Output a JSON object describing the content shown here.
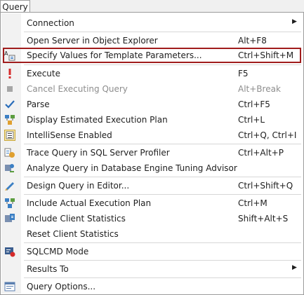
{
  "menubar": {
    "title": "Query"
  },
  "menu": {
    "connection": {
      "label": "Connection",
      "has_submenu": true
    },
    "open_server": {
      "label": "Open Server in Object Explorer",
      "shortcut": "Alt+F8"
    },
    "specify_values": {
      "label": "Specify Values for Template Parameters...",
      "shortcut": "Ctrl+Shift+M",
      "icon": "template-parameters-icon"
    },
    "execute": {
      "label": "Execute",
      "shortcut": "F5",
      "icon": "execute-icon",
      "icon_color": "#d62b2b"
    },
    "cancel": {
      "label": "Cancel Executing Query",
      "shortcut": "Alt+Break",
      "icon": "stop-icon",
      "disabled": true
    },
    "parse": {
      "label": "Parse",
      "shortcut": "Ctrl+F5",
      "icon": "checkmark-icon",
      "icon_color": "#2a6dba"
    },
    "display_plan": {
      "label": "Display Estimated Execution Plan",
      "shortcut": "Ctrl+L",
      "icon": "execution-plan-icon"
    },
    "intellisense": {
      "label": "IntelliSense Enabled",
      "shortcut": "Ctrl+Q, Ctrl+I",
      "icon": "intellisense-icon"
    },
    "trace": {
      "label": "Trace Query in SQL Server Profiler",
      "shortcut": "Ctrl+Alt+P",
      "icon": "profiler-icon"
    },
    "analyze": {
      "label": "Analyze Query in Database Engine Tuning Advisor",
      "shortcut": "",
      "icon": "tuning-advisor-icon"
    },
    "design": {
      "label": "Design Query in Editor...",
      "shortcut": "Ctrl+Shift+Q",
      "icon": "design-query-icon"
    },
    "actual_plan": {
      "label": "Include Actual Execution Plan",
      "shortcut": "Ctrl+M",
      "icon": "actual-plan-icon"
    },
    "client_stats": {
      "label": "Include Client Statistics",
      "shortcut": "Shift+Alt+S",
      "icon": "client-statistics-icon"
    },
    "reset_stats": {
      "label": "Reset Client Statistics",
      "shortcut": ""
    },
    "sqlcmd": {
      "label": "SQLCMD Mode",
      "shortcut": "",
      "icon": "sqlcmd-icon"
    },
    "results_to": {
      "label": "Results To",
      "has_submenu": true
    },
    "options": {
      "label": "Query Options...",
      "shortcut": "",
      "icon": "query-options-icon"
    }
  },
  "colors": {
    "highlight_border": "#a01c1c",
    "separator": "#d7d7d7",
    "disabled_text": "#8d8d8d"
  }
}
